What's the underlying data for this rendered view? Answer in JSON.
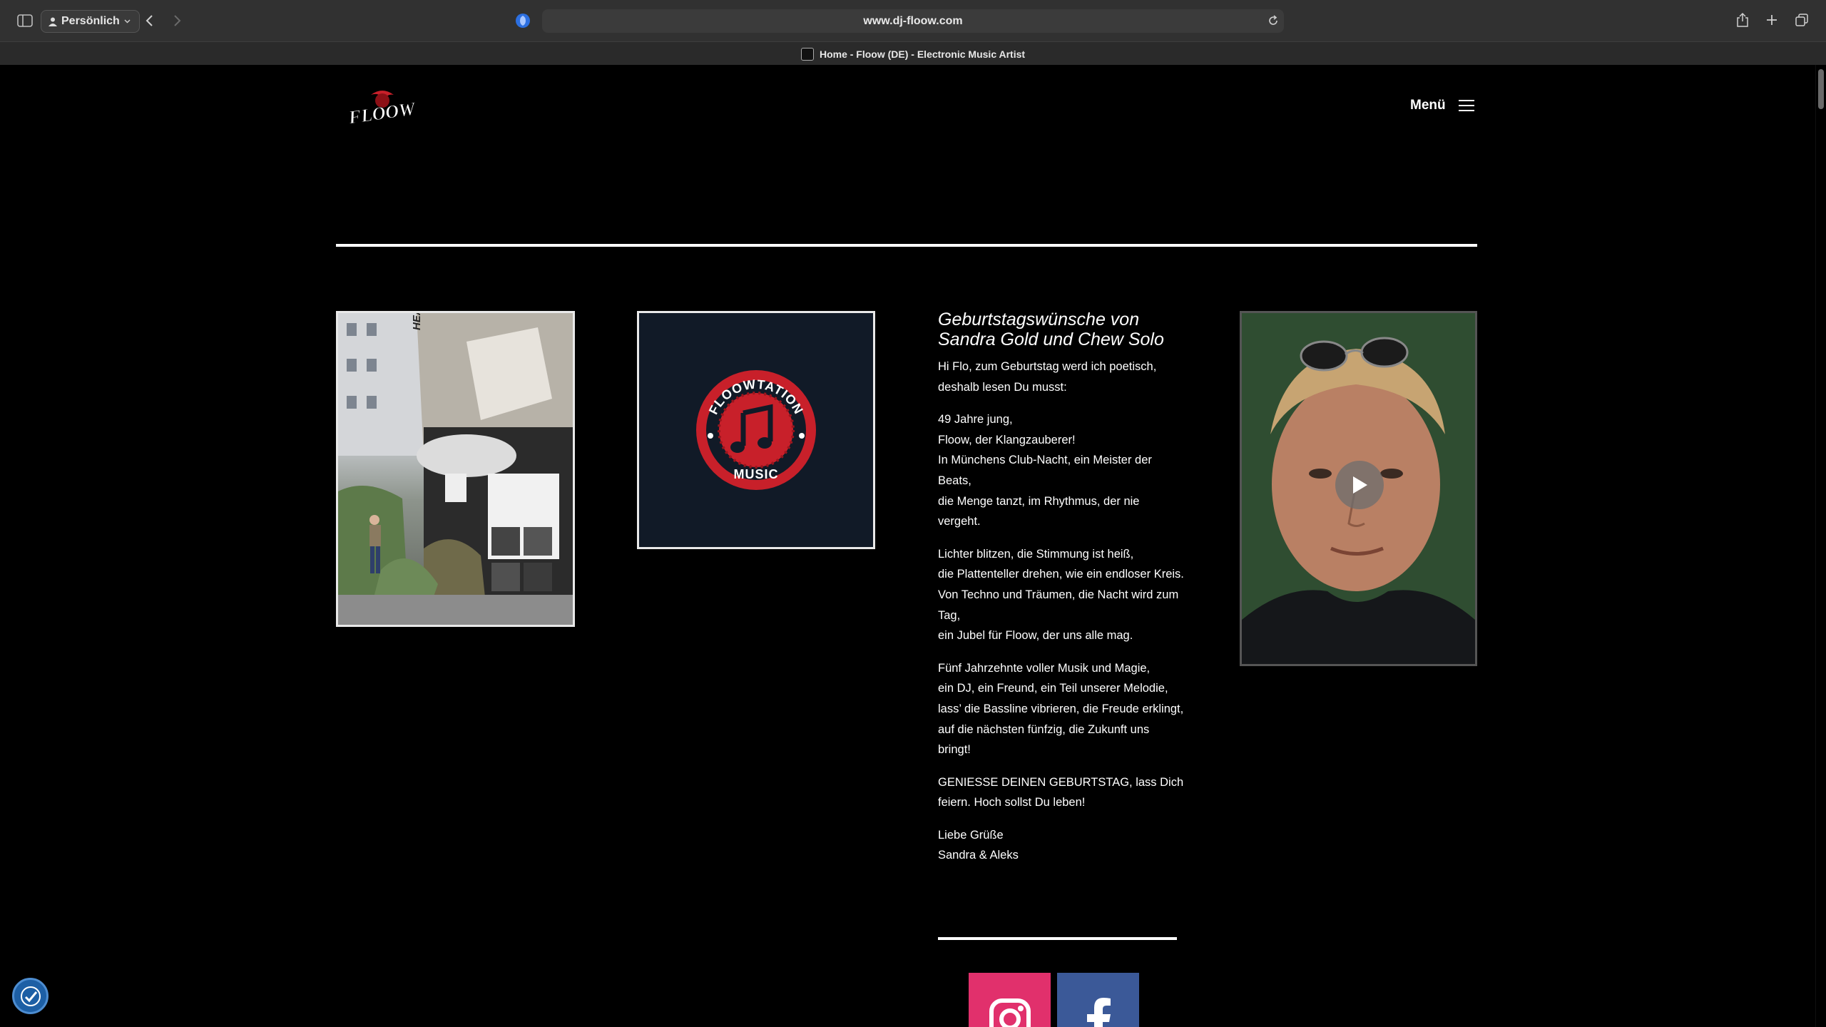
{
  "browser": {
    "profile_label": "Persönlich",
    "url": "www.dj-floow.com",
    "tab_title": "Home - Floow (DE) - Electronic Music Artist"
  },
  "header": {
    "logo_text": "FLOOW",
    "menu_label": "Menü"
  },
  "images": {
    "floowtation_top": "FLOOWTATION",
    "floowtation_bottom": "MUSIC",
    "graffiti_sign": "HEAV"
  },
  "poem": {
    "title": "Geburtstagswünsche von Sandra Gold und Chew Solo",
    "paragraphs": [
      [
        "Hi Flo, zum Geburtstag werd ich poetisch, deshalb lesen Du musst:"
      ],
      [
        "49 Jahre jung,",
        "Floow, der Klangzauberer!",
        "In Münchens Club-Nacht, ein Meister der Beats,",
        "die Menge tanzt, im Rhythmus, der nie vergeht."
      ],
      [
        "Lichter blitzen, die Stimmung ist heiß,",
        "die Plattenteller drehen, wie ein endloser Kreis.",
        "Von Techno und Träumen, die Nacht wird zum Tag,",
        "ein Jubel für Floow, der uns alle mag."
      ],
      [
        "Fünf Jahrzehnte voller Musik und Magie,",
        "ein DJ, ein Freund, ein Teil unserer Melodie,",
        "lass’ die Bassline vibrieren, die Freude erklingt,",
        "auf die nächsten fünfzig, die Zukunft uns bringt!"
      ],
      [
        "GENIESSE DEINEN GEBURTSTAG, lass Dich feiern. Hoch sollst Du leben!"
      ],
      [
        "Liebe Grüße",
        "Sandra & Aleks"
      ]
    ]
  },
  "colors": {
    "instagram": "#e1306c",
    "facebook": "#3b5998",
    "accent_red": "#c8202a"
  }
}
